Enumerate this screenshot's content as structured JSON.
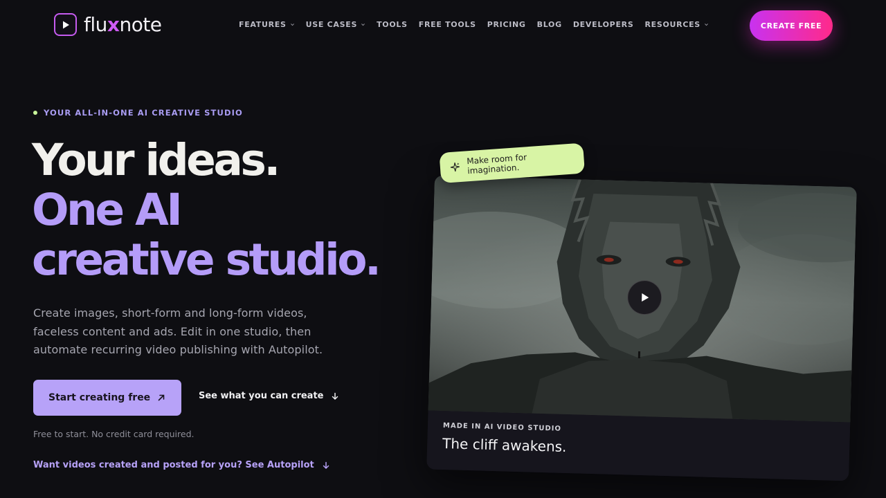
{
  "brand": {
    "name_pre": "flu",
    "name_x": "x",
    "name_post": "note"
  },
  "nav": {
    "items": [
      {
        "label": "FEATURES",
        "has_dropdown": true
      },
      {
        "label": "USE CASES",
        "has_dropdown": true
      },
      {
        "label": "TOOLS",
        "has_dropdown": false
      },
      {
        "label": "FREE TOOLS",
        "has_dropdown": false
      },
      {
        "label": "PRICING",
        "has_dropdown": false
      },
      {
        "label": "BLOG",
        "has_dropdown": false
      },
      {
        "label": "DEVELOPERS",
        "has_dropdown": false
      },
      {
        "label": "RESOURCES",
        "has_dropdown": true
      }
    ],
    "cta_label": "CREATE FREE"
  },
  "hero": {
    "eyebrow": "YOUR ALL-IN-ONE AI CREATIVE STUDIO",
    "headline_line1": "Your ideas.",
    "headline_line2": "One AI",
    "headline_line3": "creative studio.",
    "subtext": "Create images, short-form and long-form videos, faceless content and ads. Edit in one studio, then automate recurring video publishing with Autopilot.",
    "primary_cta": "Start creating free",
    "secondary_cta": "See what you can create",
    "note": "Free to start. No credit card required.",
    "autopilot_link": "Want videos created and posted for you? See Autopilot"
  },
  "showcase": {
    "pill_text": "Make room for imagination.",
    "tag": "MADE IN AI VIDEO STUDIO",
    "title": "The cliff awakens."
  },
  "colors": {
    "background": "#0e0e12",
    "accent_purple": "#b7a2f8",
    "cta_gradient_start": "#c832f0",
    "cta_gradient_end": "#ff2a8a",
    "pill_green": "#d8f4a5",
    "eyebrow_dot": "#c8f59a"
  },
  "icons": {
    "logo": "play-icon",
    "dropdown": "chevron-down-icon",
    "primary_cta": "arrow-up-right-icon",
    "secondary_cta": "arrow-down-icon",
    "pill": "sparkle-icon",
    "video": "play-icon"
  }
}
